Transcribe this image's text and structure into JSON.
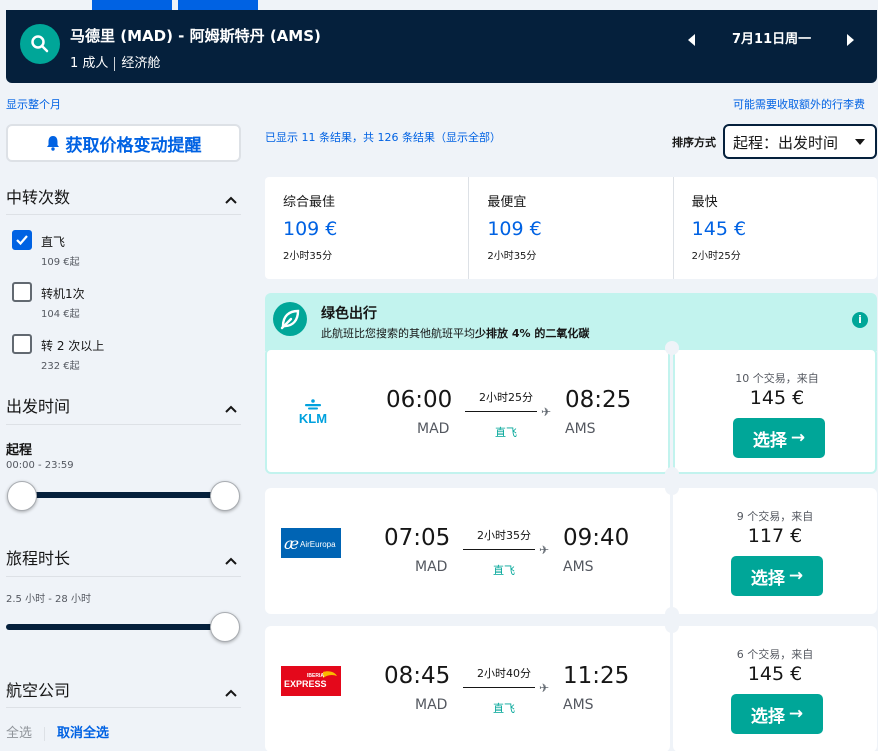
{
  "search": {
    "route": "马德里 (MAD) - 阿姆斯特丹 (AMS)",
    "passengers": "1 成人",
    "cabin": "经济舱",
    "date": "7月11日周一"
  },
  "links": {
    "whole_month": "显示整个月",
    "baggage_fee": "可能需要收取额外的行李费"
  },
  "alert_button": "获取价格变动提醒",
  "filters": {
    "stops": {
      "title": "中转次数",
      "options": [
        {
          "label": "直飞",
          "sub": "109 €起",
          "checked": true
        },
        {
          "label": "转机1次",
          "sub": "104 €起",
          "checked": false
        },
        {
          "label": "转 2 次以上",
          "sub": "232 €起",
          "checked": false
        }
      ]
    },
    "departure": {
      "title": "出发时间",
      "sub_title": "起程",
      "range": "00:00 - 23:59"
    },
    "duration": {
      "title": "旅程时长",
      "range": "2.5 小时 - 28 小时"
    },
    "airlines": {
      "title": "航空公司",
      "select_all": "全选",
      "clear_all": "取消全选"
    }
  },
  "results": {
    "count_text": "已显示 11 条结果，共 126 条结果（显示全部）",
    "sort_label": "排序方式",
    "sort_value": "起程：出发时间"
  },
  "summary": [
    {
      "title": "综合最佳",
      "price": "109 €",
      "duration": "2小时35分"
    },
    {
      "title": "最便宜",
      "price": "109 €",
      "duration": "2小时35分"
    },
    {
      "title": "最快",
      "price": "145 €",
      "duration": "2小时25分"
    }
  ],
  "eco": {
    "title": "绿色出行",
    "text_before": "此航班比您搜索的其他航班平均",
    "text_bold": "少排放 4% 的二氧化碳",
    "info": "i"
  },
  "flights": [
    {
      "logo": "KLM",
      "dep_time": "06:00",
      "dep_airport": "MAD",
      "arr_time": "08:25",
      "arr_airport": "AMS",
      "duration": "2小时25分",
      "stops": "直飞",
      "deals": "10 个交易，来自",
      "price": "145 €",
      "button": "选择"
    },
    {
      "logo": "AirEuropa",
      "dep_time": "07:05",
      "dep_airport": "MAD",
      "arr_time": "09:40",
      "arr_airport": "AMS",
      "duration": "2小时35分",
      "stops": "直飞",
      "deals": "9 个交易，来自",
      "price": "117 €",
      "button": "选择"
    },
    {
      "logo": "IBERIA EXPRESS",
      "dep_time": "08:45",
      "dep_airport": "MAD",
      "arr_time": "11:25",
      "arr_airport": "AMS",
      "duration": "2小时40分",
      "stops": "直飞",
      "deals": "6 个交易，来自",
      "price": "145 €",
      "button": "选择"
    }
  ],
  "colors": {
    "navy": "#05203c",
    "blue": "#0062e3",
    "teal": "#00a698",
    "eco_bg": "#c2f3ee",
    "page_bg": "#eff3f8"
  }
}
